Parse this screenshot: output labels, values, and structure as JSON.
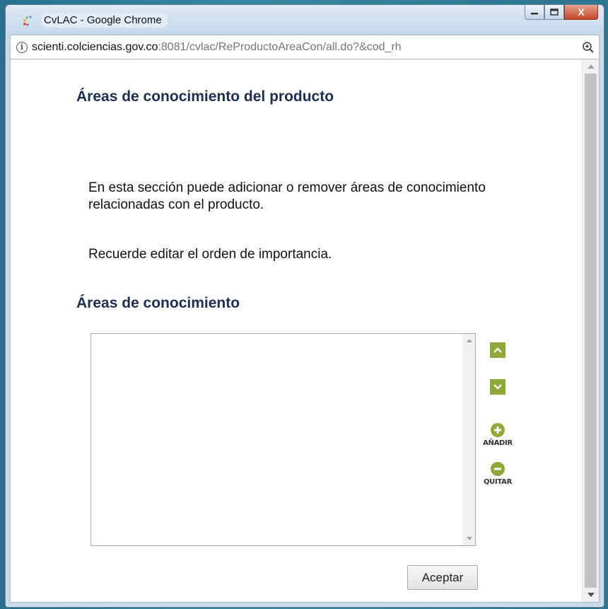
{
  "window": {
    "title": "CvLAC - Google Chrome",
    "minimize_glyph": "—",
    "maximize_glyph": "☐",
    "close_glyph": "X"
  },
  "address": {
    "info_glyph": "i",
    "url_host": "scienti.colciencias.gov.co",
    "url_path": ":8081/cvlac/ReProductoAreaCon/all.do?&cod_rh",
    "zoom_icon": "zoom-in-icon"
  },
  "page": {
    "title": "Áreas de conocimiento del producto",
    "description": "En esta sección puede adicionar o remover áreas de conocimiento relacionadas con el producto.",
    "reminder": "Recuerde editar el orden de importancia.",
    "section_title": "Áreas de conocimiento",
    "list_items": [],
    "add_label": "AÑADIR",
    "remove_label": "QUITAR",
    "accept_label": "Aceptar"
  },
  "colors": {
    "accent_green": "#8fa83a",
    "heading_navy": "#1d2f4f"
  }
}
